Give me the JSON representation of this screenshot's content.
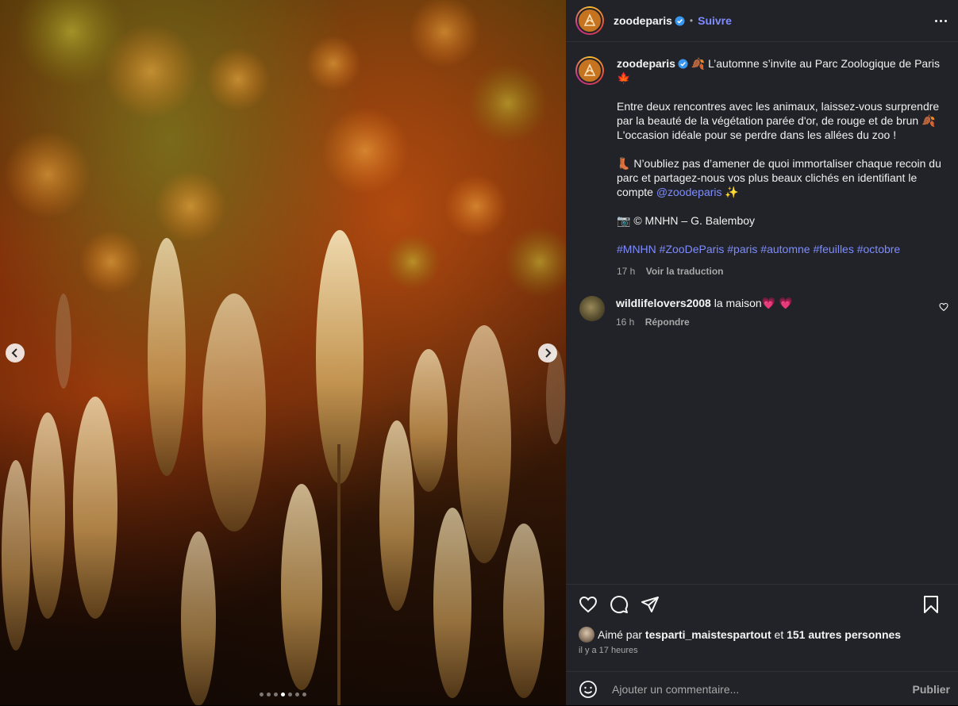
{
  "post": {
    "username": "zoodeparis",
    "follow_label": "Suivre",
    "separator": "•",
    "carousel": {
      "slide_count": 7,
      "active_index": 3
    }
  },
  "caption": {
    "username": "zoodeparis",
    "line1_emoji": "🍂",
    "line1_text": "L’automne s’invite au Parc Zoologique de Paris",
    "line1_end_emoji": "🍁",
    "para2": "Entre deux rencontres avec les animaux, laissez-vous surprendre par la beauté de la végétation parée d'or, de rouge et de brun",
    "para2_emoji": "🍂",
    "para2_end": "L'occasion idéale pour se perdre dans les allées du zoo !",
    "para3_emoji": "👢",
    "para3": "N’oubliez pas d’amener de quoi immortaliser chaque recoin du parc et partagez-nous vos plus beaux clichés en identifiant le compte",
    "para3_mention": "@zoodeparis",
    "para3_end_emoji": "✨",
    "credit_emoji": "📷",
    "credit": "© MNHN – G. Balemboy",
    "hashtags": [
      "#MNHN",
      "#ZooDeParis",
      "#paris",
      "#automne",
      "#feuilles",
      "#octobre"
    ],
    "time": "17 h",
    "translate_label": "Voir la traduction"
  },
  "comments": [
    {
      "username": "wildlifelovers2008",
      "text": "la maison",
      "emoji": "💗 💗",
      "time": "16 h",
      "reply_label": "Répondre"
    }
  ],
  "likes": {
    "prefix": "Aimé par",
    "user": "tesparti_maistespartout",
    "connector": "et",
    "others": "151 autres personnes"
  },
  "timestamp": "il y a 17 heures",
  "add_comment": {
    "placeholder": "Ajouter un commentaire...",
    "publish_label": "Publier"
  },
  "colors": {
    "panel_bg": "#212328",
    "link": "#7e8cff",
    "muted": "#a8a8a8"
  }
}
